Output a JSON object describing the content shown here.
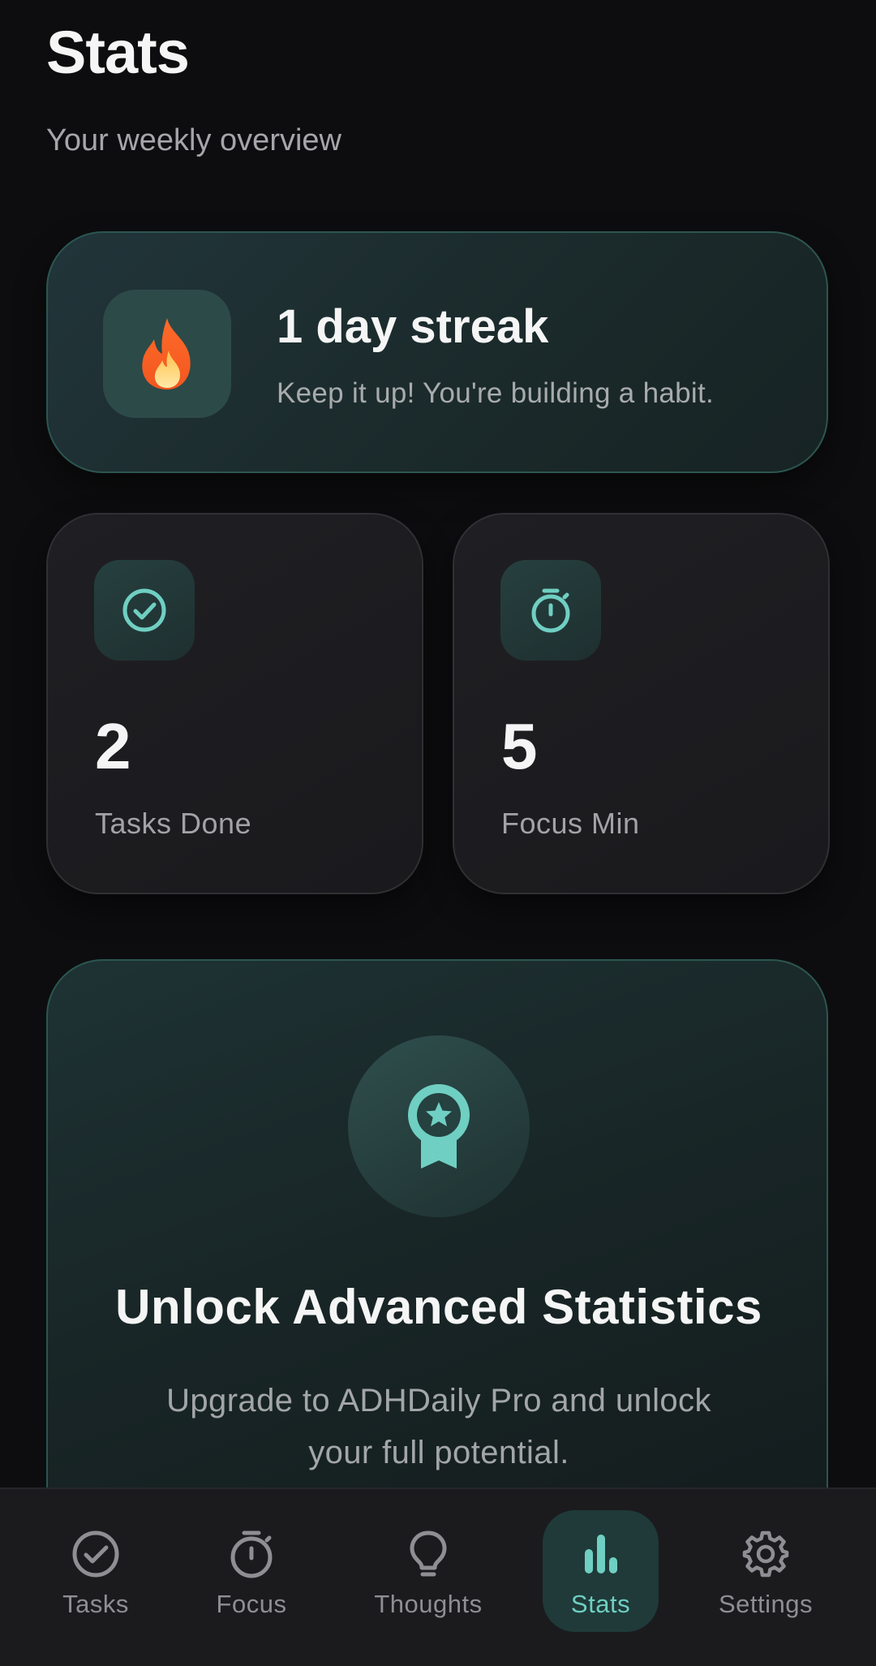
{
  "header": {
    "title": "Stats",
    "subtitle": "Your weekly overview"
  },
  "streak": {
    "icon": "flame-icon",
    "title": "1 day streak",
    "subtitle": "Keep it up! You're building a habit."
  },
  "stats": [
    {
      "icon": "check-circle-icon",
      "value": "2",
      "label": "Tasks Done"
    },
    {
      "icon": "stopwatch-icon",
      "value": "5",
      "label": "Focus Min"
    }
  ],
  "pro": {
    "icon": "award-icon",
    "title": "Unlock Advanced Statistics",
    "description": "Upgrade to ADHDaily Pro and unlock your full potential."
  },
  "nav": {
    "items": [
      {
        "label": "Tasks",
        "icon": "check-circle-icon",
        "active": false
      },
      {
        "label": "Focus",
        "icon": "stopwatch-icon",
        "active": false
      },
      {
        "label": "Thoughts",
        "icon": "lightbulb-icon",
        "active": false
      },
      {
        "label": "Stats",
        "icon": "bar-chart-icon",
        "active": true
      },
      {
        "label": "Settings",
        "icon": "gear-icon",
        "active": false
      }
    ]
  },
  "colors": {
    "accent": "#6fcfc2",
    "background": "#0d0d0f",
    "card": "#1e1e22",
    "muted_text": "#a3a3a7"
  }
}
